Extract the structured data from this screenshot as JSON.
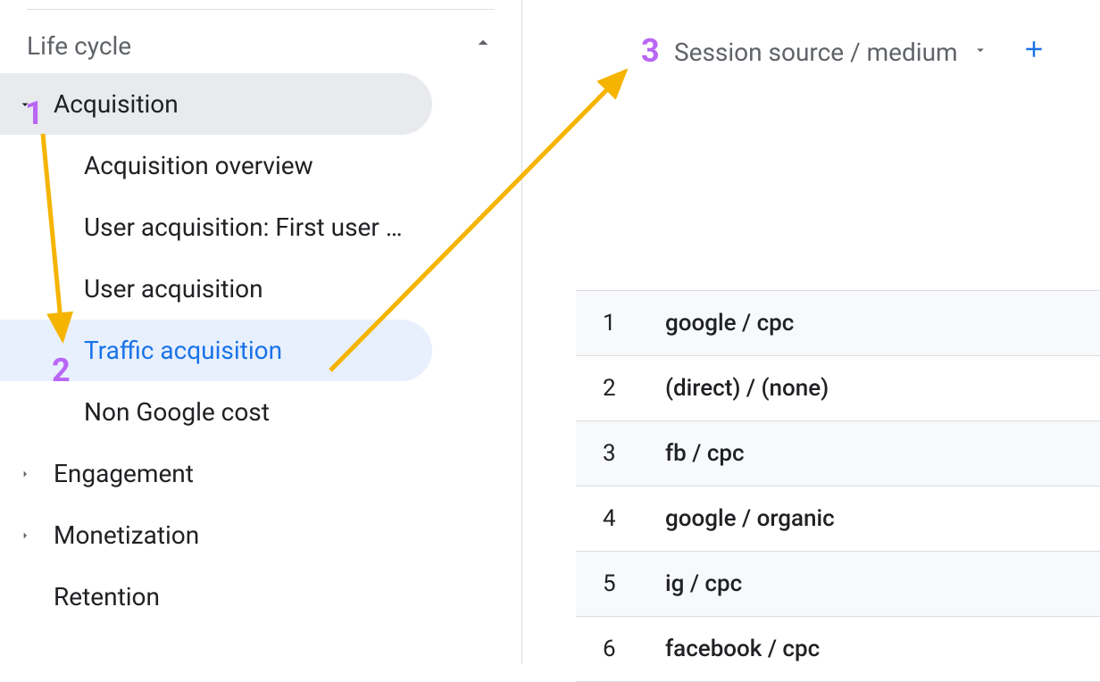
{
  "sidebar": {
    "section_title": "Life cycle",
    "acquisition": {
      "label": "Acquisition"
    },
    "items": [
      {
        "label": "Acquisition overview"
      },
      {
        "label": "User acquisition: First user …"
      },
      {
        "label": "User acquisition"
      },
      {
        "label": "Traffic acquisition"
      },
      {
        "label": "Non Google cost"
      }
    ],
    "engagement": {
      "label": "Engagement"
    },
    "monetization": {
      "label": "Monetization"
    },
    "retention": {
      "label": "Retention"
    }
  },
  "main": {
    "dimension_label": "Session source / medium",
    "rows": [
      {
        "idx": "1",
        "val": "google / cpc"
      },
      {
        "idx": "2",
        "val": "(direct) / (none)"
      },
      {
        "idx": "3",
        "val": "fb / cpc"
      },
      {
        "idx": "4",
        "val": "google / organic"
      },
      {
        "idx": "5",
        "val": "ig / cpc"
      },
      {
        "idx": "6",
        "val": "facebook / cpc"
      }
    ]
  },
  "annotations": {
    "a1": "1",
    "a2": "2",
    "a3": "3"
  }
}
